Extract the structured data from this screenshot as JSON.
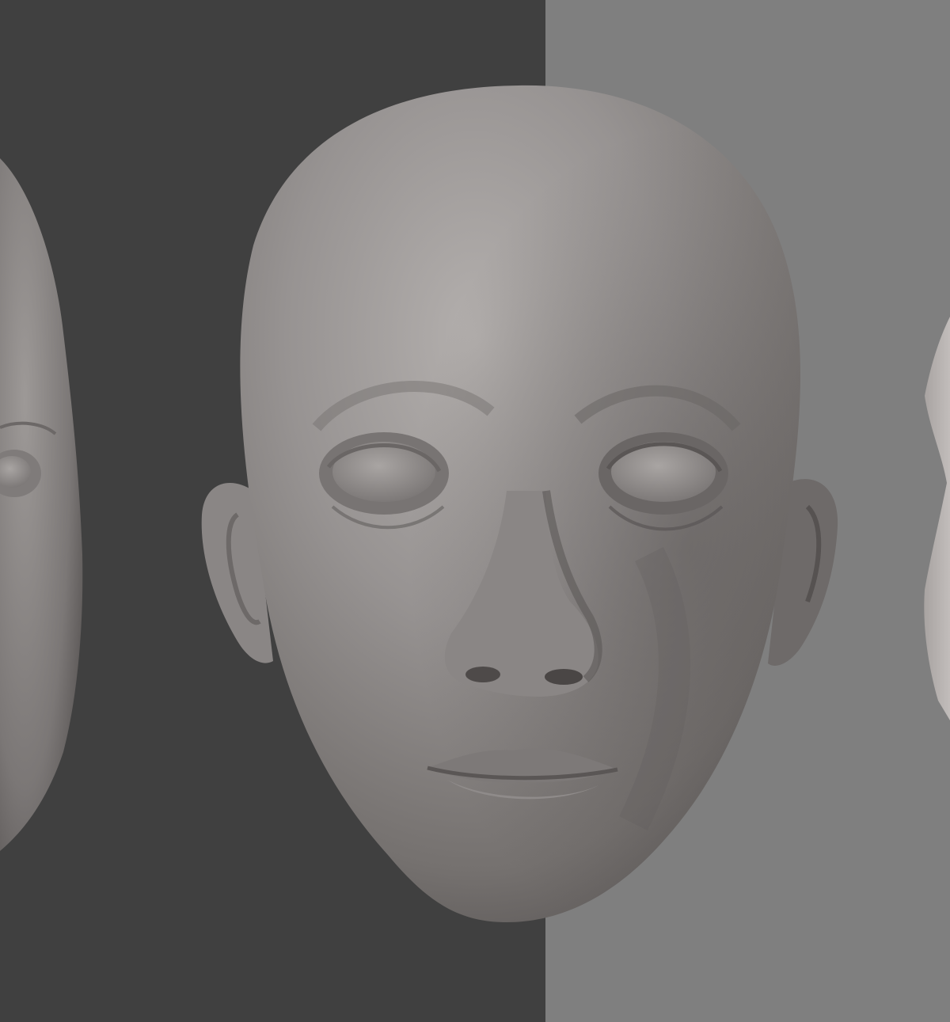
{
  "scene": {
    "description_label": "",
    "colors": {
      "backdrop_dark": "#404040",
      "backdrop_light": "#7f7f7f",
      "clay_base": "#8f8b89",
      "clay_light": "#b3afad",
      "clay_shadow": "#5c5857"
    },
    "views": [
      "three-quarter-left",
      "front",
      "side-right"
    ]
  }
}
